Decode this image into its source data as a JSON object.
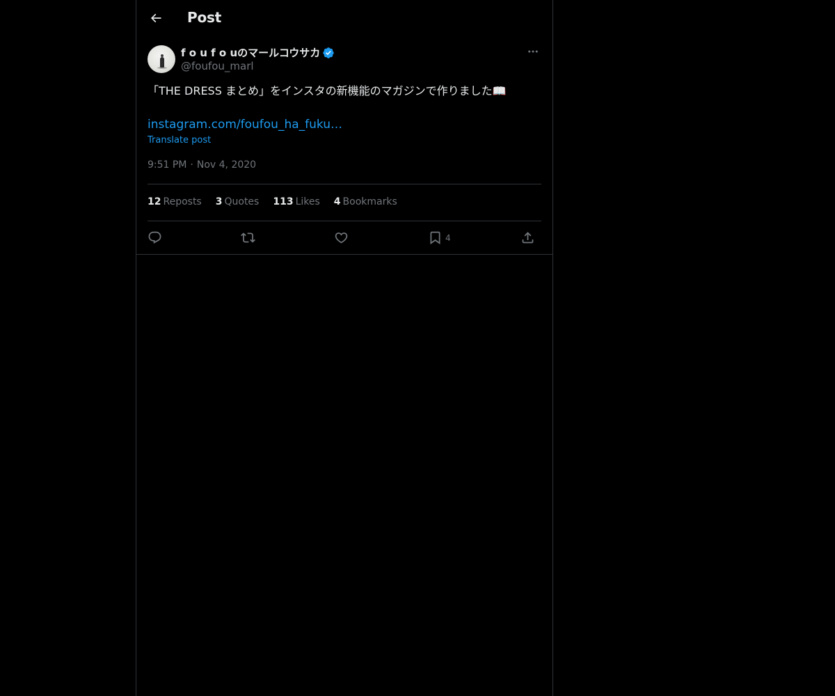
{
  "header": {
    "title": "Post"
  },
  "author": {
    "display_name": "f o u f o uのマールコウサカ",
    "handle": "@foufou_marl",
    "verified": true
  },
  "post": {
    "text": "「THE DRESS まとめ」をインスタの新機能のマガジンで作りました📖",
    "link": "instagram.com/foufou_ha_fuku…",
    "translate_label": "Translate post",
    "time": "9:51 PM",
    "date": "Nov 4, 2020"
  },
  "stats": {
    "reposts_count": "12",
    "reposts_label": "Reposts",
    "quotes_count": "3",
    "quotes_label": "Quotes",
    "likes_count": "113",
    "likes_label": "Likes",
    "bookmarks_count": "4",
    "bookmarks_label": "Bookmarks"
  },
  "actions": {
    "reply_icon": "reply-icon",
    "repost_icon": "repost-icon",
    "like_icon": "heart-icon",
    "bookmark_icon": "bookmark-icon",
    "bookmark_count": "4",
    "share_icon": "share-icon"
  },
  "colors": {
    "background": "#000000",
    "text_primary": "#e7e9ea",
    "text_secondary": "#71767b",
    "accent": "#1d9bf0",
    "border": "#2f3336"
  }
}
